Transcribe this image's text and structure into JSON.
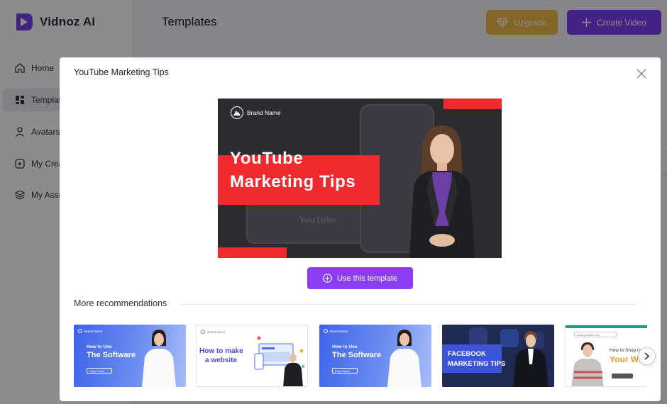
{
  "app": {
    "logo_text": "Vidnoz AI",
    "page_title": "Templates",
    "upgrade_label": "Upgrade",
    "create_label": "Create Video",
    "colors": {
      "accent": "#7b3ff2",
      "upgrade": "#f0b84a",
      "brand_red": "#ee2a2e"
    }
  },
  "sidebar": {
    "items": [
      {
        "label": "Home",
        "icon": "home-icon"
      },
      {
        "label": "Templates",
        "icon": "templates-icon",
        "active": true
      },
      {
        "label": "Avatars",
        "icon": "avatar-icon"
      },
      {
        "label": "My Creations",
        "icon": "play-icon"
      },
      {
        "label": "My Assets",
        "icon": "layers-icon"
      }
    ]
  },
  "modal": {
    "title": "YouTube Marketing Tips",
    "preview": {
      "brand": "Brand Name",
      "headline_line1": "YouTube",
      "headline_line2": "Marketing Tips",
      "bg_logo": "YouTube"
    },
    "use_label": "Use this template",
    "more_title": "More recommendations",
    "recommendations": [
      {
        "style": "blue",
        "brand": "Brand Name",
        "small": "How to Use",
        "big": "The Software",
        "guide": "Easy Guide"
      },
      {
        "style": "white",
        "brand": "Brand Name",
        "text_line1": "How to make",
        "text_line2": "a website"
      },
      {
        "style": "blue",
        "brand": "Brand Name",
        "small": "How to Use",
        "big": "The Software",
        "guide": "Easy Guide"
      },
      {
        "style": "dark",
        "text_line1": "FACEBOOK",
        "text_line2": "MARKETING TIPS"
      },
      {
        "style": "teal",
        "url": "www.yoursite.com",
        "small": "How to Shop in",
        "big": "Your Wo"
      }
    ]
  }
}
